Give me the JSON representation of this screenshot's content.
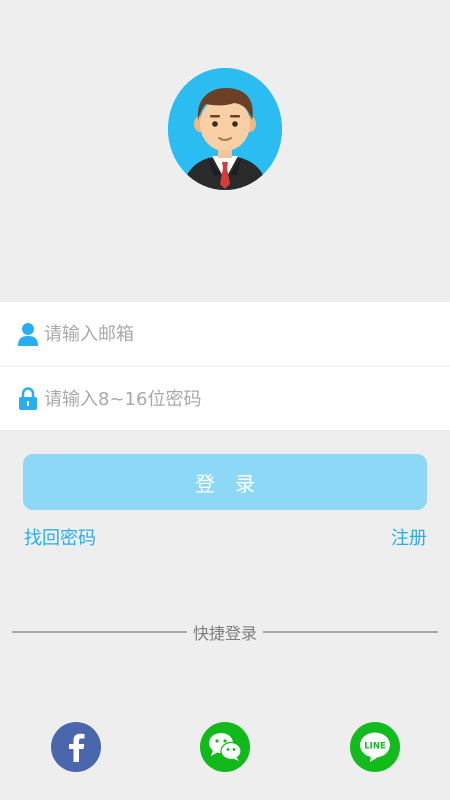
{
  "form": {
    "email_placeholder": "请输入邮箱",
    "password_placeholder": "请输入8~16位密码"
  },
  "actions": {
    "login_label": "登　录",
    "forgot_password_label": "找回密码",
    "register_label": "注册"
  },
  "quick_login": {
    "label": "快捷登录",
    "providers": [
      "facebook-icon",
      "wechat-icon",
      "line-icon"
    ]
  },
  "colors": {
    "background": "#eeeeee",
    "accent": "#27aef0",
    "login_button": "#8dd7f7",
    "avatar_bg": "#2bbdf1",
    "facebook": "#4a67ad",
    "wechat": "#12b91a",
    "line": "#13bb1c"
  }
}
